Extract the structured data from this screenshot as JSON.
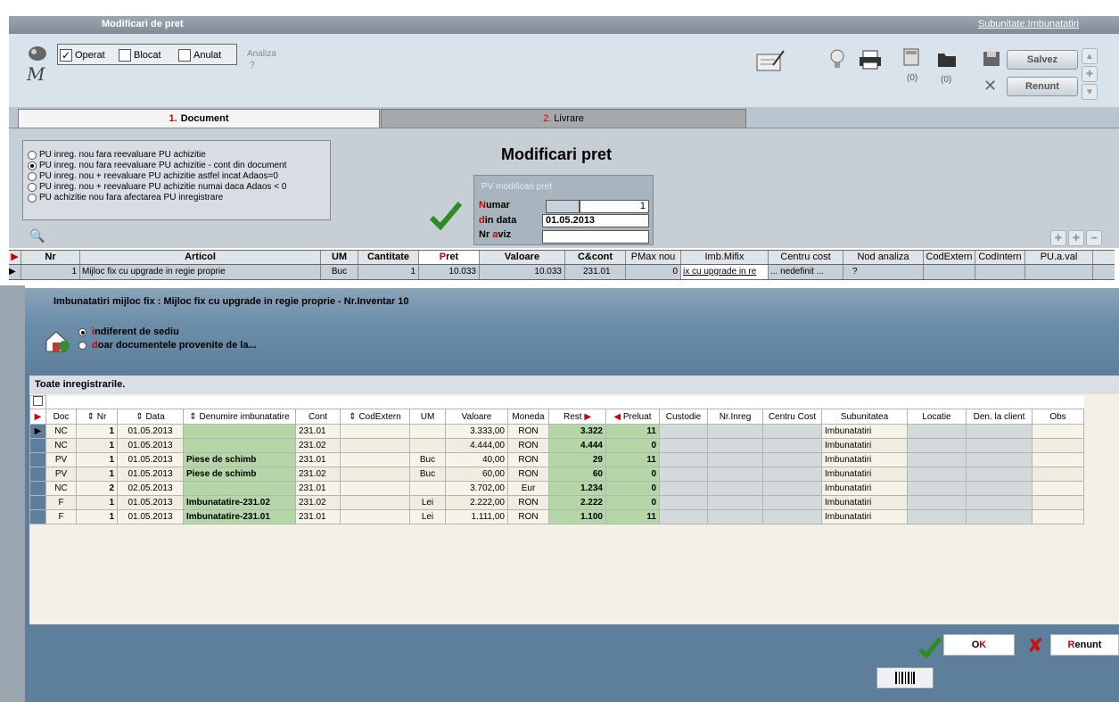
{
  "window": {
    "title": "Modificari de pret",
    "subunit": "Subunitate:Imbunatatiri"
  },
  "toolbar": {
    "operat": "Operat",
    "blocat": "Blocat",
    "anulat": "Anulat",
    "analiza": "Analiza",
    "analiza_q": "?",
    "count1": "(0)",
    "count2": "(0)",
    "save": "Salvez",
    "cancel": "Renunt"
  },
  "tabs": [
    {
      "num": "1.",
      "label": "Document"
    },
    {
      "num": "2.",
      "label": "Livrare"
    }
  ],
  "options": [
    {
      "label": "PU inreg. nou  fara reevaluare PU achizitie",
      "selected": false
    },
    {
      "label": "PU inreg. nou  fara reevaluare PU achizitie - cont din document",
      "selected": true
    },
    {
      "label": "PU inreg. nou  + reevaluare PU achizitie astfel incat Adaos=0",
      "selected": false
    },
    {
      "label": "PU inreg. nou  + reevaluare PU achizitie numai daca Adaos < 0",
      "selected": false
    },
    {
      "label": "PU achizitie nou fara afectarea PU inregistrare",
      "selected": false
    }
  ],
  "document": {
    "heading": "Modificari pret",
    "pv_title": "PV modificari pret",
    "numar_first": "N",
    "numar_rest": "umar",
    "numar": "1",
    "din_first": "d",
    "din_rest": "in data",
    "din_data": "01.05.2013",
    "aviz_a": "Nr ",
    "aviz_b": "a",
    "aviz_c": "viz"
  },
  "grid": {
    "headers": [
      "Nr",
      "Articol",
      "UM",
      "Cantitate",
      "Pret",
      "Valoare",
      "C&cont",
      "PMax nou",
      "Imb.Mifix",
      "Centru cost",
      "Nod analiza",
      "CodExtern",
      "CodIntern",
      "PU.a.val"
    ],
    "pret_first": "P",
    "pret_rest": "ret",
    "row": {
      "nr": "1",
      "articol": "Mijloc fix cu upgrade in regie proprie",
      "um": "Buc",
      "cantitate": "1",
      "pret": "10.033",
      "valoare": "10.033",
      "cont": "231.01",
      "pmax": "0",
      "imb": "ix cu upgrade in re",
      "centru": "... nedefinit ...",
      "nod": "?"
    }
  },
  "dialog": {
    "title": "Imbunatatiri mijloc fix : Mijloc fix cu upgrade in regie proprie - Nr.Inventar 10",
    "opt1_first": "i",
    "opt1_rest": "ndiferent de sediu",
    "opt2_first": "d",
    "opt2_rest": "oar documentele provenite de la...",
    "all_records": "Toate inregistrarile.",
    "columns": [
      "Doc",
      "Nr",
      "Data",
      "Denumire imbunatatire",
      "Cont",
      "CodExtern",
      "UM",
      "Valoare",
      "Moneda",
      "Rest",
      "Preluat",
      "Custodie",
      "Nr.Inreg",
      "Centru Cost",
      "Subunitatea",
      "Locatie",
      "Den. la client",
      "Obs"
    ],
    "rows": [
      {
        "doc": "NC",
        "nr": "1",
        "data": "01.05.2013",
        "den": "",
        "cont": "231.01",
        "um": "",
        "valoare": "3.333,00",
        "moneda": "RON",
        "rest": "3.322",
        "preluat": "11",
        "sub": "Imbunatatiri"
      },
      {
        "doc": "NC",
        "nr": "1",
        "data": "01.05.2013",
        "den": "",
        "cont": "231.02",
        "um": "",
        "valoare": "4.444,00",
        "moneda": "RON",
        "rest": "4.444",
        "preluat": "0",
        "sub": "Imbunatatiri"
      },
      {
        "doc": "PV",
        "nr": "1",
        "data": "01.05.2013",
        "den": "Piese de schimb",
        "cont": "231.01",
        "um": "Buc",
        "valoare": "40,00",
        "moneda": "RON",
        "rest": "29",
        "preluat": "11",
        "sub": "Imbunatatiri"
      },
      {
        "doc": "PV",
        "nr": "1",
        "data": "01.05.2013",
        "den": "Piese de schimb",
        "cont": "231.02",
        "um": "Buc",
        "valoare": "60,00",
        "moneda": "RON",
        "rest": "60",
        "preluat": "0",
        "sub": "Imbunatatiri"
      },
      {
        "doc": "NC",
        "nr": "2",
        "data": "02.05.2013",
        "den": "",
        "cont": "231.01",
        "um": "",
        "valoare": "3.702,00",
        "moneda": "Eur",
        "rest": "1.234",
        "preluat": "0",
        "sub": "Imbunatatiri"
      },
      {
        "doc": "F",
        "nr": "1",
        "data": "01.05.2013",
        "den": "Imbunatatire-231.02",
        "cont": "231.02",
        "um": "Lei",
        "valoare": "2.222,00",
        "moneda": "RON",
        "rest": "2.222",
        "preluat": "0",
        "sub": "Imbunatatiri"
      },
      {
        "doc": "F",
        "nr": "1",
        "data": "01.05.2013",
        "den": "Imbunatatire-231.01",
        "cont": "231.01",
        "um": "Lei",
        "valoare": "1.111,00",
        "moneda": "RON",
        "rest": "1.100",
        "preluat": "11",
        "sub": "Imbunatatiri"
      }
    ],
    "ok_first": "O",
    "ok_rest": "K",
    "cancel_first": "R",
    "cancel_rest": "enunt"
  },
  "colors": {
    "accent_red": "#cc0000",
    "check_green": "#2e8b1e",
    "dialog_bg": "#5d7f9b",
    "highlight_green": "#b5d6a7"
  }
}
